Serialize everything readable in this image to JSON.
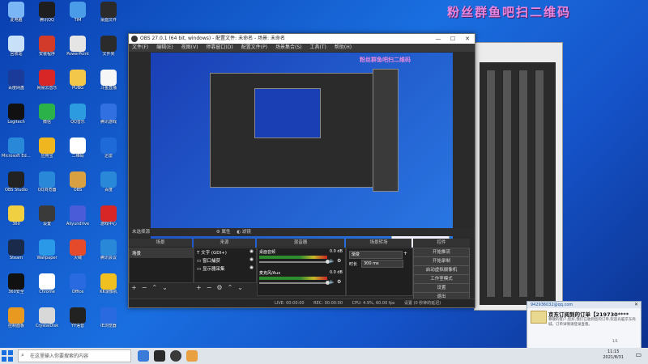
{
  "desktop": {
    "watermark": "粉丝群鱼吧扫二维码",
    "icons": [
      {
        "label": "此电脑",
        "color": "#7ab6f5"
      },
      {
        "label": "腾讯QQ",
        "color": "#1e1e1e"
      },
      {
        "label": "TIM",
        "color": "#4a9be8"
      },
      {
        "label": "桌面文件",
        "color": "#2b2b2b"
      },
      {
        "label": "回收站",
        "color": "#c8e0f8"
      },
      {
        "label": "安装程序",
        "color": "#d23a2a"
      },
      {
        "label": "PowerPoint",
        "color": "#e5e5e5"
      },
      {
        "label": "文件夹",
        "color": "#2b2b2b"
      },
      {
        "label": "百度网盘",
        "color": "#1b3b9a"
      },
      {
        "label": "网易云音乐",
        "color": "#d82626"
      },
      {
        "label": "PUBG",
        "color": "#f2c74a"
      },
      {
        "label": "斗鱼直播",
        "color": "#f6f6f6"
      },
      {
        "label": "Logitech",
        "color": "#111111"
      },
      {
        "label": "微信",
        "color": "#2bb34a"
      },
      {
        "label": "QQ音乐",
        "color": "#2d9be0"
      },
      {
        "label": "腾讯游戏",
        "color": "#3070e0"
      },
      {
        "label": "Microsoft Edge",
        "color": "#2a88d8"
      },
      {
        "label": "应用宝",
        "color": "#f0b620"
      },
      {
        "label": "二维码",
        "color": "#ffffff"
      },
      {
        "label": "迅雷",
        "color": "#1d6ad8"
      },
      {
        "label": "OBS Studio",
        "color": "#222222"
      },
      {
        "label": "QQ浏览器",
        "color": "#2a88d8"
      },
      {
        "label": "OBS",
        "color": "#d8a040"
      },
      {
        "label": "百度",
        "color": "#2a88d8"
      },
      {
        "label": "360",
        "color": "#f0d040"
      },
      {
        "label": "设置",
        "color": "#3a3a3a"
      },
      {
        "label": "Aliyundrive",
        "color": "#4a5cd8"
      },
      {
        "label": "游戏中心",
        "color": "#d82626"
      },
      {
        "label": "Steam",
        "color": "#1a2a4a"
      },
      {
        "label": "Wallpaper",
        "color": "#2a9ae8"
      },
      {
        "label": "火绒",
        "color": "#e54a2a"
      },
      {
        "label": "腾讯会议",
        "color": "#2a88d8"
      },
      {
        "label": "360安全",
        "color": "#111111"
      },
      {
        "label": "Chrome",
        "color": "#ffffff"
      },
      {
        "label": "Office",
        "color": "#2a6ae0"
      },
      {
        "label": "KK录像机",
        "color": "#f0c020"
      },
      {
        "label": "控制面板",
        "color": "#e89a20"
      },
      {
        "label": "CrystalDisk",
        "color": "#d8d8d8"
      },
      {
        "label": "YY语音",
        "color": "#222222"
      },
      {
        "label": "IE浏览器",
        "color": "#2a6ae0"
      }
    ]
  },
  "obs": {
    "title": "OBS 27.0.1 (64 bit, windows) - 配置文件: 未命名 - 场景: 未命名",
    "menu": [
      "文件(F)",
      "编辑(E)",
      "视图(V)",
      "停靠窗口(D)",
      "配置文件(P)",
      "场景集合(S)",
      "工具(T)",
      "帮助(H)"
    ],
    "preview_watermark": "粉丝群鱼吧扫二维码",
    "source_hint": "未选择源",
    "source_props": "属性",
    "source_filters": "滤镜",
    "docks": {
      "scenes": {
        "title": "场景",
        "items": [
          "场景"
        ]
      },
      "sources": {
        "title": "来源",
        "items": [
          "文字 (GDI+)",
          "窗口捕获",
          "显示器采集"
        ]
      },
      "mixer": {
        "title": "混音器",
        "channels": [
          {
            "name": "桌面音频",
            "db": "0.0 dB"
          },
          {
            "name": "麦克风/Aux",
            "db": "0.0 dB"
          }
        ]
      },
      "transitions": {
        "title": "场景转场",
        "type": "渐变",
        "duration_label": "时长",
        "duration_value": "300 ms"
      },
      "controls": {
        "title": "控件",
        "buttons": [
          "开始推流",
          "开始录制",
          "启动虚拟摄像机",
          "工作室模式",
          "设置",
          "退出"
        ]
      }
    },
    "status": {
      "live": "LIVE: 00:00:00",
      "rec": "REC: 00:00:00",
      "cpu": "CPU: 4.9%, 60.00 fps",
      "extra": "设置 (0 秒钟的延迟)"
    }
  },
  "toast": {
    "header": "942936032@qq.com",
    "title": "京东订阅到的订单【219730****",
    "body": "尊敬的客户,您好,我们已收到您的订单,欢迎光临京东商城。订单详情请登录查看。",
    "page": "1/1"
  },
  "taskbar": {
    "search_placeholder": "在这里输入你要搜索的内容",
    "time": "11:15",
    "date": "2021/8/31"
  }
}
